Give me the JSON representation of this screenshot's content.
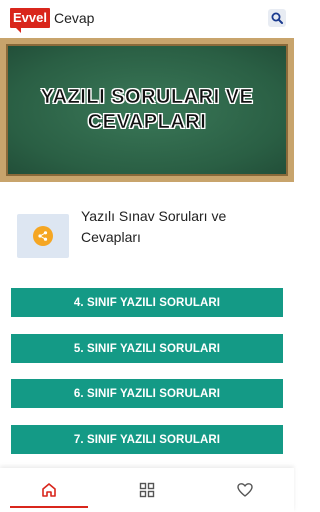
{
  "header": {
    "logo_red": "Evvel",
    "logo_text": "Cevap",
    "search_icon": "search-icon"
  },
  "banner": {
    "title": "YAZILI SORULARI VE CEVAPLARI"
  },
  "card": {
    "title": "Yazılı Sınav Soruları ve Cevapları",
    "share_icon": "share-icon"
  },
  "buttons": [
    {
      "label": "4. SINIF YAZILI SORULARI"
    },
    {
      "label": "5. SINIF YAZILI SORULARI"
    },
    {
      "label": "6. SINIF YAZILI SORULARI"
    },
    {
      "label": "7. SINIF YAZILI SORULARI"
    }
  ],
  "bottom_nav": {
    "items": [
      {
        "icon": "home-icon",
        "active": true
      },
      {
        "icon": "grid-icon",
        "active": false
      },
      {
        "icon": "heart-icon",
        "active": false
      }
    ]
  },
  "colors": {
    "accent": "#d9261c",
    "button": "#149a86",
    "share": "#f5a623",
    "chalkboard": "#2e6a4c",
    "frame": "#c8a46c"
  }
}
